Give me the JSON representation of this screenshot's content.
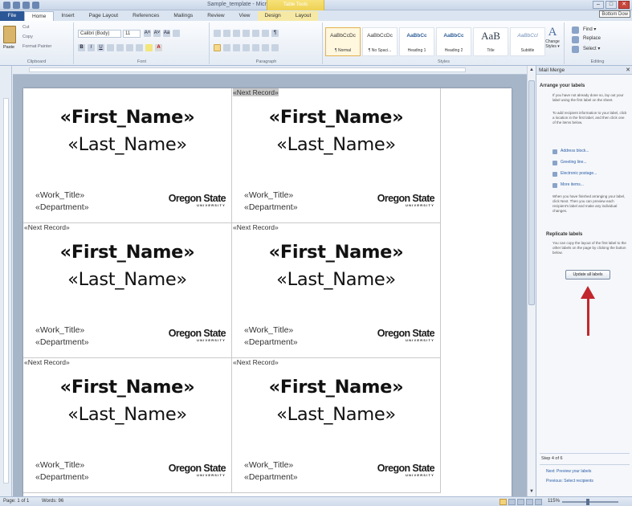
{
  "window": {
    "title": "Sample_template - Microsoft Word",
    "contextual_tab_group": "Table Tools",
    "minimize": "–",
    "maximize": "□",
    "close": "✕"
  },
  "ribbon_tabs": [
    "File",
    "Home",
    "Insert",
    "Page Layout",
    "References",
    "Mailings",
    "Review",
    "View",
    "Design",
    "Layout"
  ],
  "tooltip": "Bottom Dow",
  "clipboard": {
    "paste": "Paste",
    "cut": "Cut",
    "copy": "Copy",
    "format_painter": "Format Painter",
    "group_label": "Clipboard"
  },
  "font": {
    "family": "Calibri (Body)",
    "size": "11",
    "bold": "B",
    "italic": "I",
    "underline": "U",
    "font_color": "A",
    "grow": "A˄",
    "shrink": "A˅",
    "change_case": "Aa",
    "group_label": "Font"
  },
  "paragraph": {
    "group_label": "Paragraph",
    "pilcrow": "¶"
  },
  "styles": {
    "group_label": "Styles",
    "items": [
      {
        "sample": "AaBbCcDc",
        "name": "¶ Normal"
      },
      {
        "sample": "AaBbCcDc",
        "name": "¶ No Spaci..."
      },
      {
        "sample": "AaBbCc",
        "name": "Heading 1"
      },
      {
        "sample": "AaBbCc",
        "name": "Heading 2"
      },
      {
        "sample": "AaB",
        "name": "Title"
      },
      {
        "sample": "AaBbCcl",
        "name": "Subtitle"
      }
    ],
    "change_styles_icon": "A",
    "change_styles": "Change Styles ▾"
  },
  "editing": {
    "find": "Find ▾",
    "replace": "Replace",
    "select": "Select ▾",
    "group_label": "Editing"
  },
  "document": {
    "labels": [
      {
        "next_record": "«Next Record»",
        "first_name": "«First_Name»",
        "last_name": "«Last_Name»",
        "work_title": "«Work_Title»",
        "department": "«Department»",
        "logo": "Oregon State",
        "logo_sub": "UNIVERSITY"
      },
      {
        "next_record": "«Next Record»",
        "first_name": "«First_Name»",
        "last_name": "«Last_Name»",
        "work_title": "«Work_Title»",
        "department": "«Department»",
        "logo": "Oregon State",
        "logo_sub": "UNIVERSITY"
      },
      {
        "next_record": "«Next Record»",
        "first_name": "«First_Name»",
        "last_name": "«Last_Name»",
        "work_title": "«Work_Title»",
        "department": "«Department»",
        "logo": "Oregon State",
        "logo_sub": "UNIVERSITY"
      },
      {
        "next_record": "«Next Record»",
        "first_name": "«First_Name»",
        "last_name": "«Last_Name»",
        "work_title": "«Work_Title»",
        "department": "«Department»",
        "logo": "Oregon State",
        "logo_sub": "UNIVERSITY"
      },
      {
        "next_record": "«Next Record»",
        "first_name": "«First_Name»",
        "last_name": "«Last_Name»",
        "work_title": "«Work_Title»",
        "department": "«Department»",
        "logo": "Oregon State",
        "logo_sub": "UNIVERSITY"
      },
      {
        "next_record": "«Next Record»",
        "first_name": "«First_Name»",
        "last_name": "«Last_Name»",
        "work_title": "«Work_Title»",
        "department": "«Department»",
        "logo": "Oregon State",
        "logo_sub": "UNIVERSITY"
      }
    ]
  },
  "mail_merge_pane": {
    "title": "Mail Merge",
    "close": "✕",
    "arrange_heading": "Arrange your labels",
    "arrange_text_1": "If you have not already done so, lay out your label using the first label on the sheet.",
    "arrange_text_2": "To add recipient information to your label, click a location in the first label, and then click one of the items below.",
    "links": [
      "Address block...",
      "Greeting line...",
      "Electronic postage...",
      "More items..."
    ],
    "arrange_text_3": "When you have finished arranging your label, click Next. Then you can preview each recipient's label and make any individual changes.",
    "replicate_heading": "Replicate labels",
    "replicate_text": "You can copy the layout of the first label to the other labels on the page by clicking the button below.",
    "update_button": "Update all labels",
    "step": "Step 4 of 6",
    "next_link": "Next: Preview your labels",
    "prev_link": "Previous: Select recipients"
  },
  "status_bar": {
    "page": "Page: 1 of 1",
    "words": "Words: 96",
    "zoom": "115%"
  },
  "colors": {
    "annotation_arrow": "#c1272d",
    "file_tab": "#2b5797",
    "context_tab": "#eed152"
  }
}
